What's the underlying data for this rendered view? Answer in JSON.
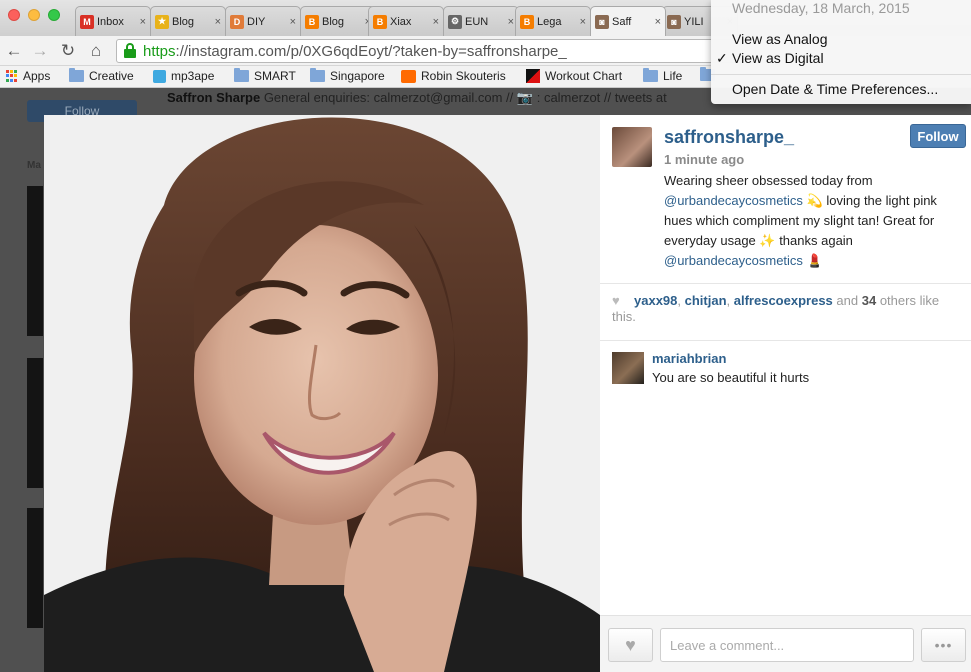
{
  "browser": {
    "tabs": [
      {
        "title": "Inbox",
        "icon": "gmail-icon",
        "color": "#d93025",
        "glyph": "M"
      },
      {
        "title": "Blog",
        "icon": "star-icon",
        "color": "#e8b21a",
        "glyph": "★"
      },
      {
        "title": "DIY",
        "icon": "diy-icon",
        "color": "#e07b39",
        "glyph": "D"
      },
      {
        "title": "Blog",
        "icon": "blogger-icon",
        "color": "#f57d00",
        "glyph": "B"
      },
      {
        "title": "Xiax",
        "icon": "blogger-icon",
        "color": "#f57d00",
        "glyph": "B"
      },
      {
        "title": "EUN",
        "icon": "gear-icon",
        "color": "#666666",
        "glyph": "⚙"
      },
      {
        "title": "Lega",
        "icon": "blogger-icon",
        "color": "#f57d00",
        "glyph": "B"
      },
      {
        "title": "Saff",
        "icon": "instagram-icon",
        "color": "#8a6a52",
        "glyph": "◙"
      },
      {
        "title": "YILI",
        "icon": "instagram-icon",
        "color": "#8a6a52",
        "glyph": "◙"
      }
    ],
    "tab_close_glyph": "×",
    "url": {
      "scheme": "https",
      "rest": "://instagram.com/p/0XG6qdEoyt/?taken-by=saffronsharpe_"
    },
    "bookmarks": [
      {
        "label": "Apps",
        "icon": "apps-icon"
      },
      {
        "label": "Creative",
        "icon": "folder-icon"
      },
      {
        "label": "mp3ape",
        "icon": "mp3ape-icon"
      },
      {
        "label": "SMART",
        "icon": "folder-icon"
      },
      {
        "label": "Singapore",
        "icon": "folder-icon"
      },
      {
        "label": "Robin Skouteris",
        "icon": "soundcloud-icon"
      },
      {
        "label": "Workout Chart",
        "icon": "workout-chart-icon"
      },
      {
        "label": "Life",
        "icon": "folder-icon"
      }
    ]
  },
  "background_page": {
    "follow_label": "Follow",
    "profile_name": "Saffron Sharpe",
    "bio_text": "General enquiries: calmerzot@gmail.com //",
    "bio_text_2": ": calmerzot // tweets at",
    "side_label": "Ma"
  },
  "post": {
    "username": "saffronsharpe_",
    "follow_label": "Follow",
    "time_ago": "1 minute ago",
    "caption_parts": {
      "p1": "Wearing sheer obsessed today from",
      "mention1": "@urbandecaycosmetics",
      "p2": "💫 loving the light pink hues which compliment my slight tan! Great for everyday usage ✨ thanks again",
      "mention2": "@urbandecaycosmetics",
      "p3": "💄"
    },
    "likes": {
      "likers": [
        "yaxx98",
        "chitjan",
        "alfrescoexpress"
      ],
      "and_text": "and",
      "count": "34",
      "suffix": "others like this."
    },
    "comments": [
      {
        "user": "mariahbrian",
        "text": "You are so beautiful it hurts"
      }
    ],
    "comment_placeholder": "Leave a comment...",
    "more_glyph": "•••"
  },
  "clock_menu": {
    "date": "Wednesday, 18 March, 2015",
    "items": [
      {
        "label": "View as Analog",
        "checked": false
      },
      {
        "label": "View as Digital",
        "checked": true
      },
      {
        "label": "Open Date & Time Preferences...",
        "checked": false
      }
    ],
    "check_glyph": "✓"
  },
  "colors": {
    "link": "#2d5f8b",
    "follow_button": "#4d7fb3",
    "secure_green": "#1a9c1a"
  }
}
